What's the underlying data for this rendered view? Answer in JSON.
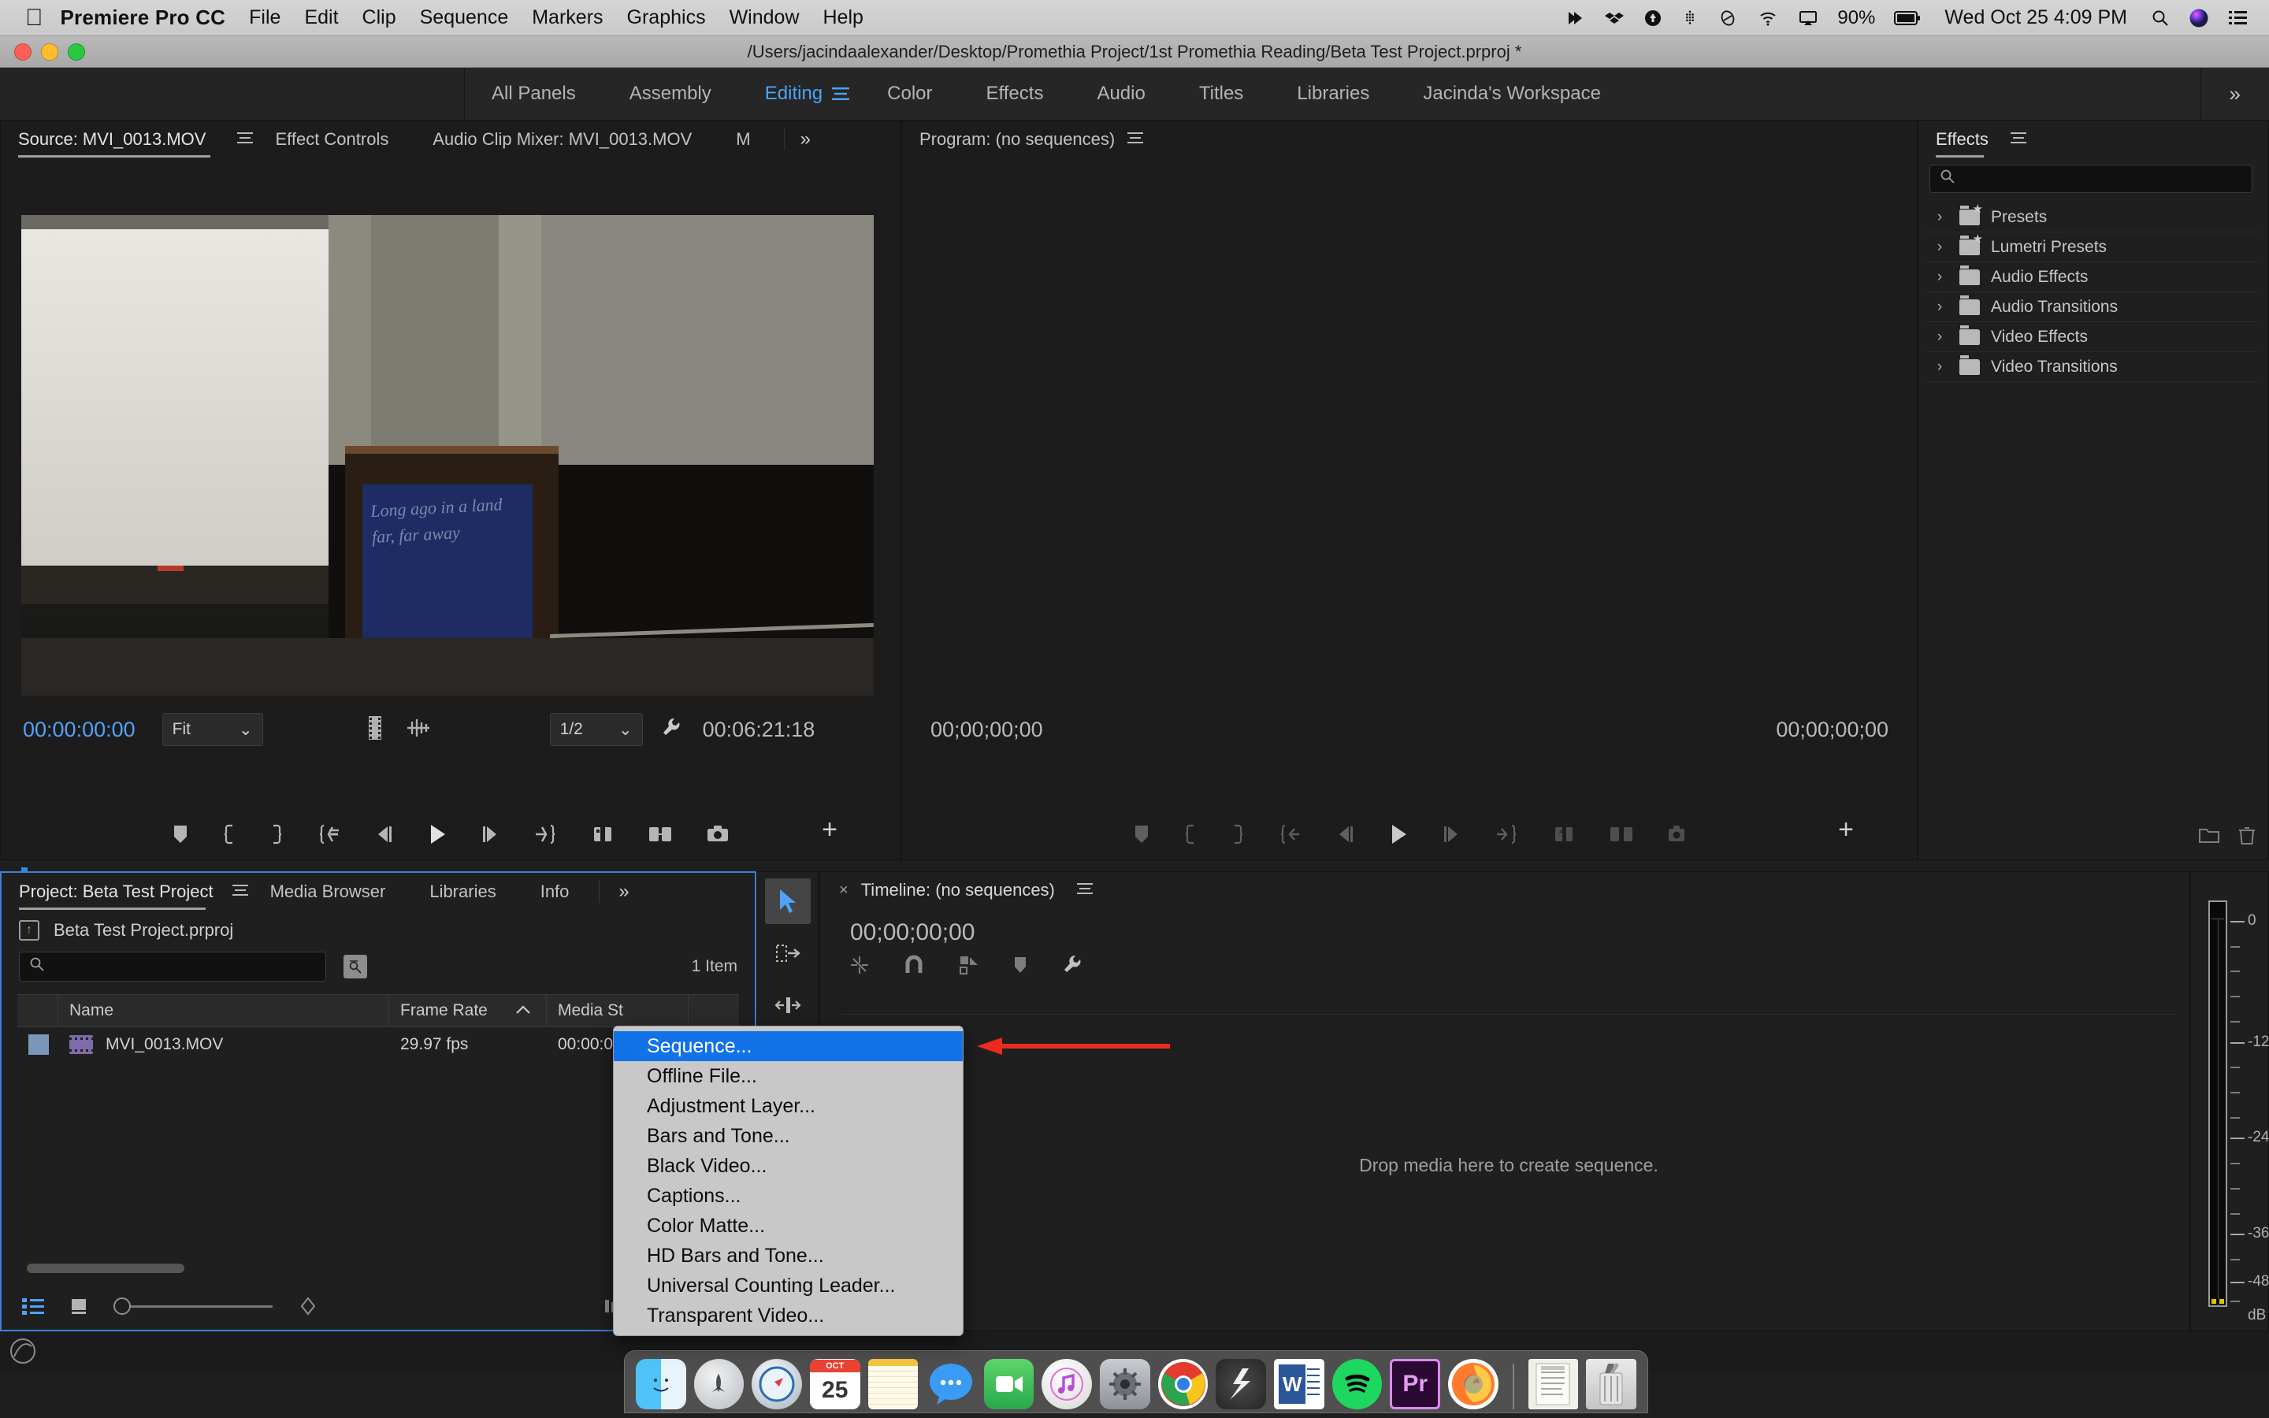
{
  "macbar": {
    "apple_icon": "apple-icon",
    "app_name": "Premiere Pro CC",
    "menus": [
      "File",
      "Edit",
      "Clip",
      "Sequence",
      "Markers",
      "Graphics",
      "Window",
      "Help"
    ],
    "status_icons": [
      "airplay-mirror-icon",
      "dropbox-icon",
      "headphones-icon",
      "wifi-tether-icon",
      "backblaze-icon",
      "search-spotlight-icon",
      "dropbox-sync-icon",
      "cloud-icon",
      "timemachine-icon",
      "wifi-icon",
      "display-icon"
    ],
    "battery_percent": "90%",
    "clock": "Wed Oct 25  4:09 PM",
    "right_icons": [
      "search-icon",
      "siri-icon",
      "control-center-icon"
    ]
  },
  "titlebar": {
    "path": "/Users/jacindaalexander/Desktop/Promethia Project/1st Promethia Reading/Beta Test Project.prproj *"
  },
  "workspace": {
    "tabs": [
      {
        "label": "All Panels",
        "active": false
      },
      {
        "label": "Assembly",
        "active": false
      },
      {
        "label": "Editing",
        "active": true
      },
      {
        "label": "Color",
        "active": false
      },
      {
        "label": "Effects",
        "active": false
      },
      {
        "label": "Audio",
        "active": false
      },
      {
        "label": "Titles",
        "active": false
      },
      {
        "label": "Libraries",
        "active": false
      },
      {
        "label": "Jacinda's Workspace",
        "active": false
      }
    ],
    "overflow": "»"
  },
  "source_monitor": {
    "tabs": [
      "Source: MVI_0013.MOV",
      "Effect Controls",
      "Audio Clip Mixer: MVI_0013.MOV",
      "M"
    ],
    "overflow": "»",
    "menu_icon": "panel-menu-icon",
    "current_timecode": "00:00:00:00",
    "duration_timecode": "00:06:21:18",
    "zoom_level": "Fit",
    "playback_resolution": "1/2",
    "banner_text": "Long ago in a land far, far away"
  },
  "program_monitor": {
    "title": "Program: (no sequences)",
    "menu_icon": "panel-menu-icon",
    "left_timecode": "00;00;00;00",
    "right_timecode": "00;00;00;00"
  },
  "effects_panel": {
    "title": "Effects",
    "menu_icon": "panel-menu-icon",
    "search_placeholder": "",
    "items": [
      {
        "label": "Presets",
        "icon": "folder-star-icon"
      },
      {
        "label": "Lumetri Presets",
        "icon": "folder-star-icon"
      },
      {
        "label": "Audio Effects",
        "icon": "folder-icon"
      },
      {
        "label": "Audio Transitions",
        "icon": "folder-icon"
      },
      {
        "label": "Video Effects",
        "icon": "folder-icon"
      },
      {
        "label": "Video Transitions",
        "icon": "folder-icon"
      }
    ],
    "bottom_icons": [
      "new-custom-bin-icon",
      "delete-icon"
    ]
  },
  "project_panel": {
    "tabs": [
      {
        "label": "Project: Beta Test Project",
        "active": true
      },
      {
        "label": "Media Browser",
        "active": false
      },
      {
        "label": "Libraries",
        "active": false
      },
      {
        "label": "Info",
        "active": false
      }
    ],
    "overflow": "»",
    "menu_icon": "panel-menu-icon",
    "root_name": "Beta Test Project.prproj",
    "search_placeholder": "",
    "item_count": "1 Item",
    "columns": [
      "",
      "Name",
      "Frame Rate",
      "Media St"
    ],
    "sort_column": "Frame Rate",
    "sort_direction": "ascending",
    "rows": [
      {
        "name": "MVI_0013.MOV",
        "frame_rate": "29.97 fps",
        "media_start": "00:00:0"
      }
    ],
    "toolbar_icons": [
      "list-view-icon",
      "icon-view-icon",
      "zoom-slider",
      "sort-icon",
      "freeform-icon",
      "find-icon",
      "new-bin-icon"
    ]
  },
  "tools_panel": {
    "tools": [
      {
        "name": "selection-tool",
        "glyph": "➤",
        "active": true
      },
      {
        "name": "track-select-forward-tool",
        "glyph": "⇥",
        "active": false
      },
      {
        "name": "ripple-edit-tool",
        "glyph": "⇹",
        "active": false
      }
    ]
  },
  "timeline_panel": {
    "close_label": "×",
    "title": "Timeline: (no sequences)",
    "menu_icon": "panel-menu-icon",
    "timecode": "00;00;00;00",
    "tool_icons": [
      "nest-sequence-icon",
      "snap-icon",
      "linked-selection-icon",
      "add-marker-icon",
      "timeline-settings-icon"
    ],
    "empty_message": "Drop media here to create sequence."
  },
  "audio_meter": {
    "ticks": [
      "0",
      "-12",
      "-24",
      "-36",
      "-48",
      "dB"
    ]
  },
  "context_menu": {
    "items": [
      {
        "label": "Sequence...",
        "selected": true
      },
      {
        "label": "Offline File...",
        "selected": false
      },
      {
        "label": "Adjustment Layer...",
        "selected": false
      },
      {
        "label": "Bars and Tone...",
        "selected": false
      },
      {
        "label": "Black Video...",
        "selected": false
      },
      {
        "label": "Captions...",
        "selected": false
      },
      {
        "label": "Color Matte...",
        "selected": false
      },
      {
        "label": "HD Bars and Tone...",
        "selected": false
      },
      {
        "label": "Universal Counting Leader...",
        "selected": false
      },
      {
        "label": "Transparent Video...",
        "selected": false
      }
    ]
  },
  "annotation": {
    "arrow_color": "#ec2a1e",
    "arrow_name": "red-arrow-pointing-to-sequence"
  },
  "dock": {
    "items": [
      {
        "name": "finder",
        "label": "",
        "running": true
      },
      {
        "name": "launchpad",
        "label": "",
        "running": false
      },
      {
        "name": "safari",
        "label": "",
        "running": true
      },
      {
        "name": "calendar",
        "label": "25",
        "running": false
      },
      {
        "name": "notes",
        "label": "",
        "running": false
      },
      {
        "name": "messages",
        "label": "",
        "running": false
      },
      {
        "name": "facetime",
        "label": "",
        "running": false
      },
      {
        "name": "itunes",
        "label": "",
        "running": false
      },
      {
        "name": "system-preferences",
        "label": "",
        "running": false
      },
      {
        "name": "chrome",
        "label": "",
        "running": false
      },
      {
        "name": "final-cut",
        "label": "",
        "running": false
      },
      {
        "name": "word",
        "label": "W",
        "running": false
      },
      {
        "name": "spotify",
        "label": "",
        "running": true
      },
      {
        "name": "premiere-pro",
        "label": "Pr",
        "running": true
      },
      {
        "name": "firefox",
        "label": "",
        "running": false
      }
    ],
    "trailing": [
      {
        "name": "documents-stack"
      },
      {
        "name": "trash"
      }
    ]
  },
  "colors": {
    "accent_blue": "#4ea3f7",
    "selection_blue": "#1272e8",
    "panel_bg": "#1f1f1f",
    "app_bg": "#1e1e1e"
  }
}
